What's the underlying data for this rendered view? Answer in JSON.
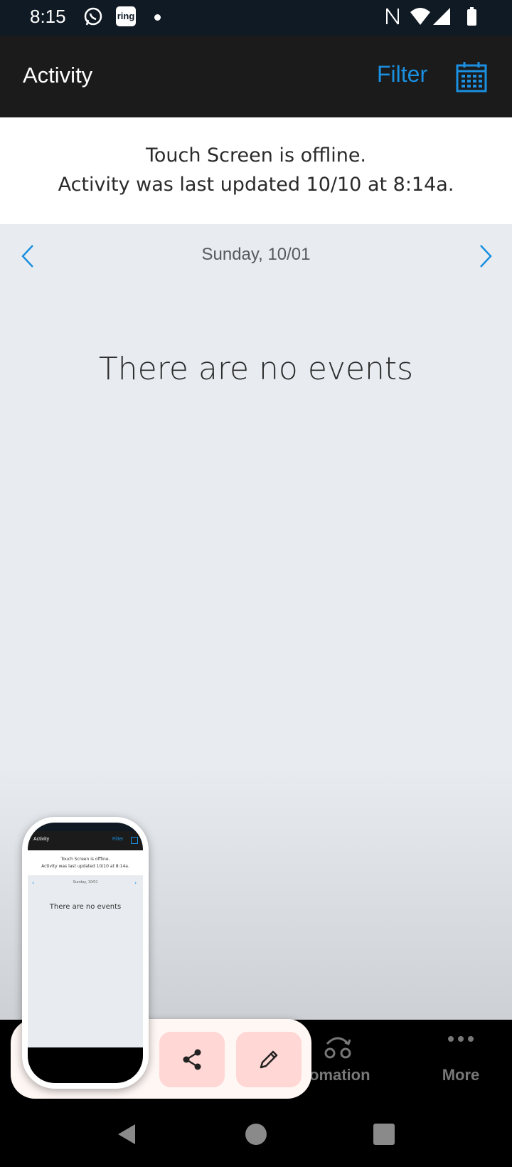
{
  "status_bar": {
    "time": "8:15",
    "ring_label": "ring",
    "icons": [
      "whatsapp-icon",
      "ring-icon",
      "notification-dot-icon",
      "nfc-icon",
      "wifi-icon",
      "signal-icon",
      "battery-icon"
    ]
  },
  "app_bar": {
    "title": "Activity",
    "filter_label": "Filter",
    "calendar_icon": "calendar-icon"
  },
  "offline_banner": {
    "line1": "Touch Screen is offline.",
    "line2": "Activity was last updated 10/10 at 8:14a."
  },
  "date_nav": {
    "date": "Sunday, 10/01"
  },
  "empty_state": {
    "message": "There are no events"
  },
  "tab_bar": {
    "tabs": [
      {
        "label": "omation",
        "icon": "automation-icon"
      },
      {
        "label": "More",
        "icon": "more-dots-icon"
      }
    ]
  },
  "screenshot_preview": {
    "actions": [
      {
        "name": "share",
        "icon": "share-icon"
      },
      {
        "name": "edit",
        "icon": "pencil-icon"
      }
    ],
    "thumbnail": {
      "title": "Activity",
      "filter": "Filter",
      "banner_line1": "Touch Screen is offline.",
      "banner_line2": "Activity was last updated 10/10 at 8:14a.",
      "date": "Sunday, 10/01",
      "empty": "There are no events"
    }
  },
  "colors": {
    "accent": "#1b8fe0",
    "app_bar": "#1b1b1b",
    "status_bar": "#0f1a24",
    "content_bg": "#e8ecf0",
    "action_button": "#ffd7d4"
  }
}
